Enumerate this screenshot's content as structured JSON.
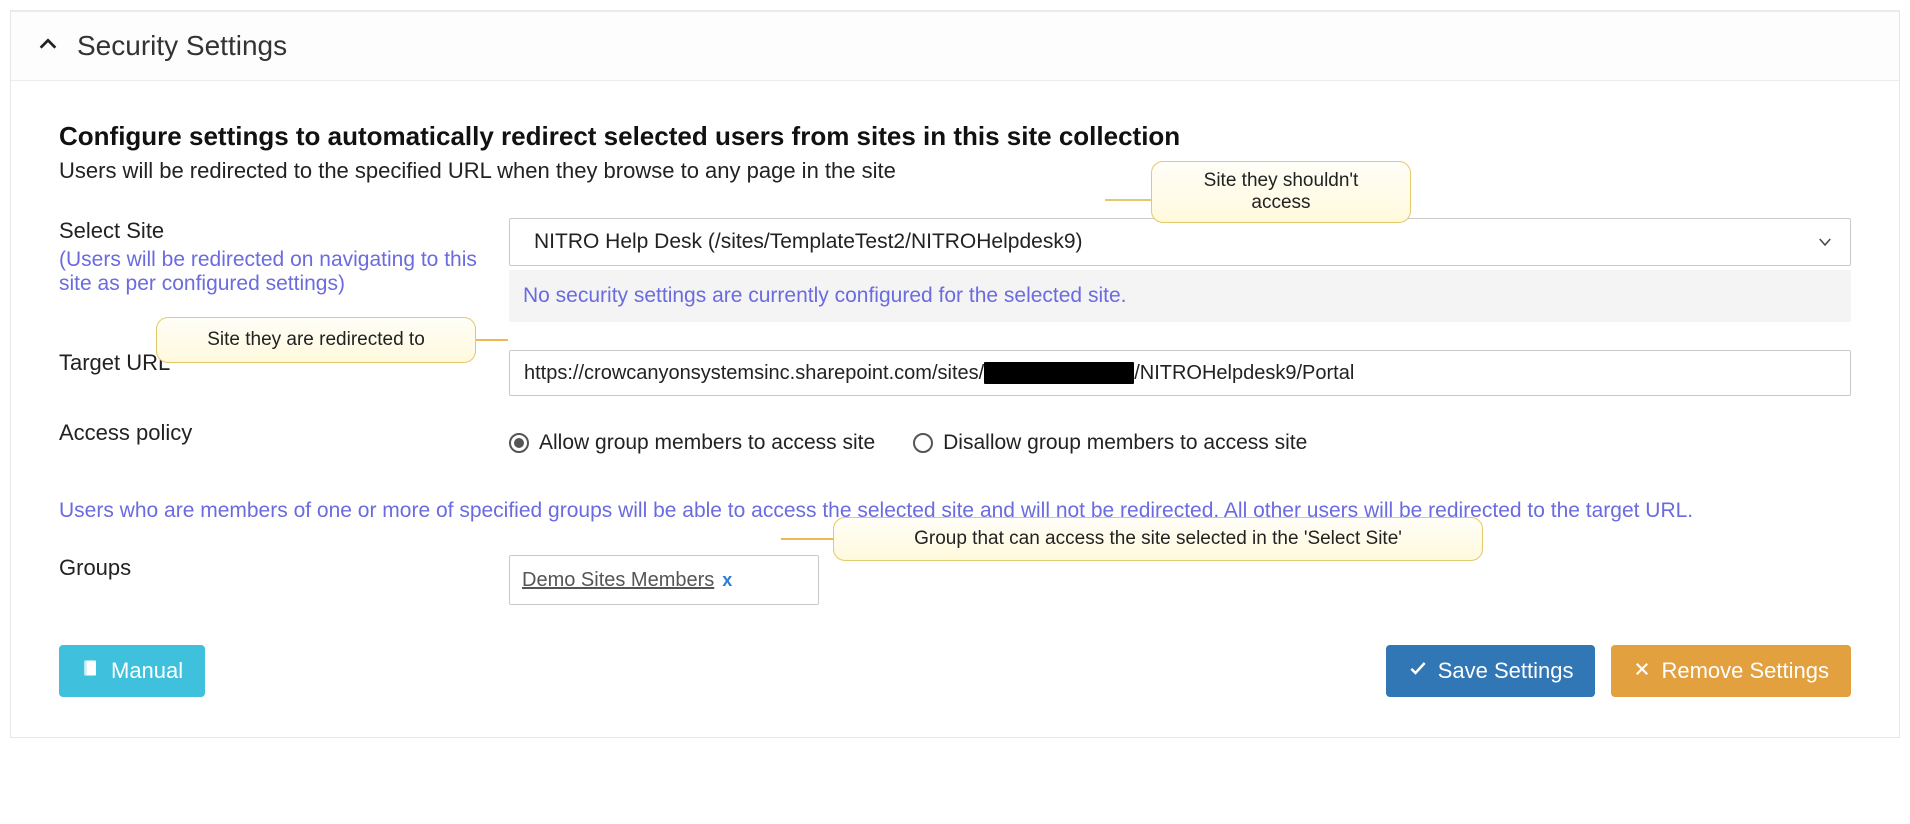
{
  "panel": {
    "title": "Security Settings"
  },
  "section": {
    "heading": "Configure settings to automatically redirect selected users from sites in this site collection",
    "subheading": " Users will be redirected to the specified URL when they browse to any page in the site"
  },
  "form": {
    "select_site": {
      "label": "Select Site",
      "help": "(Users will be redirected on navigating to this site as per configured settings)",
      "value": "NITRO Help Desk (/sites/TemplateTest2/NITROHelpdesk9)",
      "status": "No security settings are currently configured for the selected site."
    },
    "target_url": {
      "label": "Target URL",
      "value_prefix": "https://crowcanyonsystemsinc.sharepoint.com/sites/",
      "value_suffix": "/NITROHelpdesk9/Portal"
    },
    "access_policy": {
      "label": "Access policy",
      "options": [
        "Allow group members to access site",
        "Disallow group members to access site"
      ],
      "selected_index": 0,
      "note": "Users who are members of one or more of specified groups will be able to access the selected site and will not be redirected. All other users will be redirected to the target URL."
    },
    "groups": {
      "label": "Groups",
      "values": [
        "Demo Sites Members"
      ],
      "remove_glyph": "x"
    }
  },
  "buttons": {
    "manual": "Manual",
    "save": "Save Settings",
    "remove": "Remove Settings"
  },
  "callouts": {
    "site_no_access": {
      "line1": "Site they shouldn't",
      "line2": "access"
    },
    "redirected_to": "Site they are redirected to",
    "group_access": "Group that can access the site selected in the 'Select Site'"
  }
}
